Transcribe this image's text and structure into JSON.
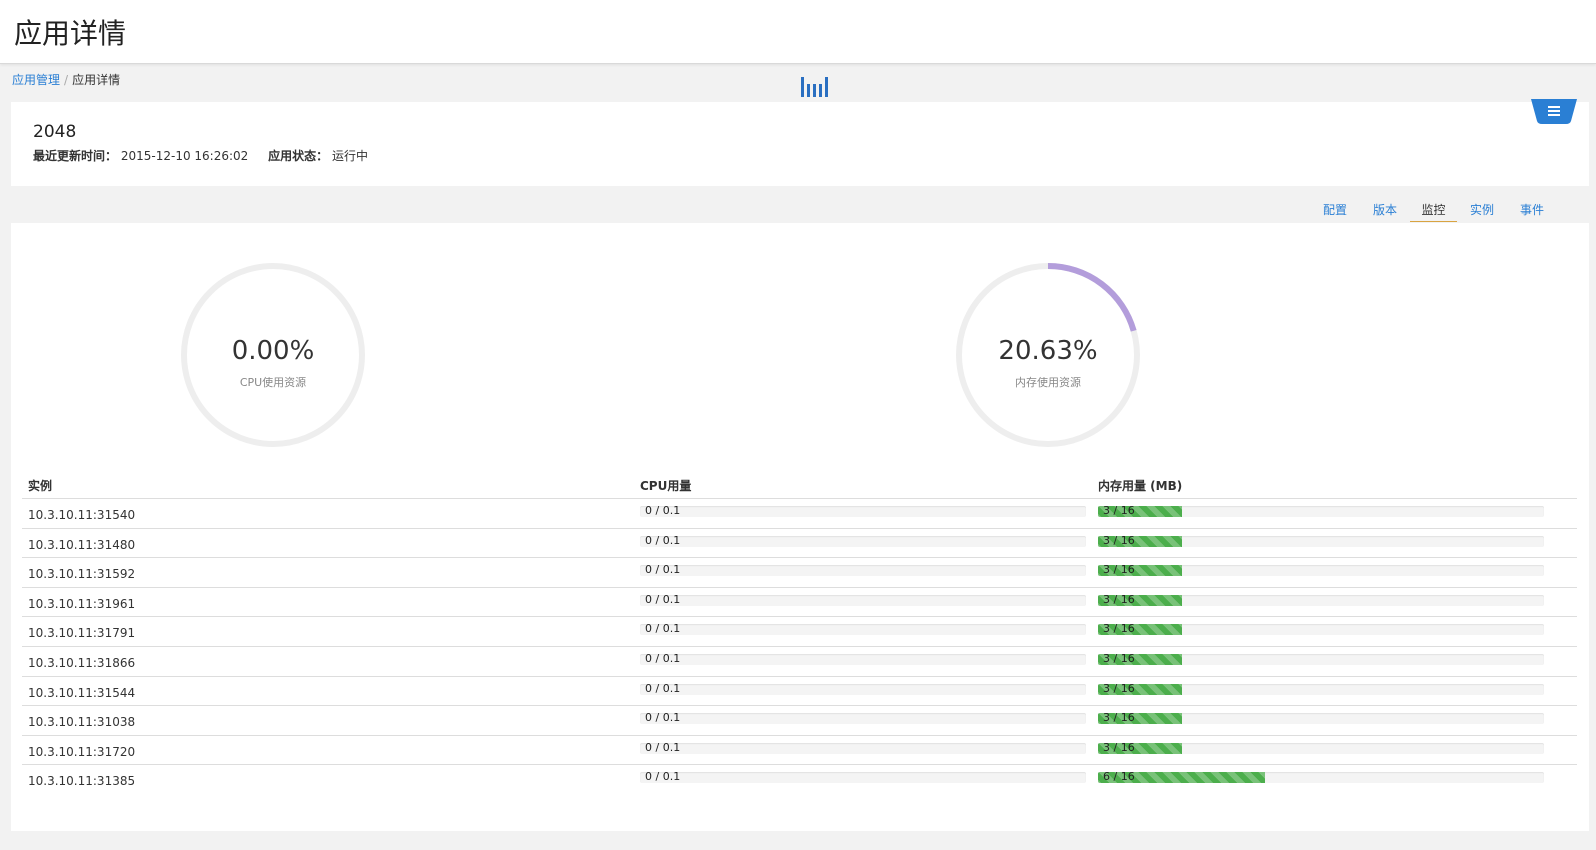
{
  "page": {
    "title": "应用详情"
  },
  "breadcrumb": {
    "parent": "应用管理",
    "separator": "/",
    "current": "应用详情"
  },
  "app": {
    "name": "2048",
    "updated_label": "最近更新时间：",
    "updated_value": "2015-12-10 16:26:02",
    "status_label": "应用状态：",
    "status_value": "运行中"
  },
  "tabs": [
    {
      "label": "配置",
      "active": false
    },
    {
      "label": "版本",
      "active": false
    },
    {
      "label": "监控",
      "active": true
    },
    {
      "label": "实例",
      "active": false
    },
    {
      "label": "事件",
      "active": false
    }
  ],
  "gauges": [
    {
      "value": "0.00%",
      "label": "CPU使用资源",
      "fraction": 0.0,
      "color": "#b39ddb"
    },
    {
      "value": "20.63%",
      "label": "内存使用资源",
      "fraction": 0.2063,
      "color": "#b39ddb"
    }
  ],
  "table": {
    "headers": {
      "instance": "实例",
      "cpu": "CPU用量",
      "mem": "内存用量 (MB)"
    },
    "rows": [
      {
        "instance": "10.3.10.11:31540",
        "cpu": "0 / 0.1",
        "cpu_fraction": 0,
        "mem": "3 / 16",
        "mem_fraction": 0.1875
      },
      {
        "instance": "10.3.10.11:31480",
        "cpu": "0 / 0.1",
        "cpu_fraction": 0,
        "mem": "3 / 16",
        "mem_fraction": 0.1875
      },
      {
        "instance": "10.3.10.11:31592",
        "cpu": "0 / 0.1",
        "cpu_fraction": 0,
        "mem": "3 / 16",
        "mem_fraction": 0.1875
      },
      {
        "instance": "10.3.10.11:31961",
        "cpu": "0 / 0.1",
        "cpu_fraction": 0,
        "mem": "3 / 16",
        "mem_fraction": 0.1875
      },
      {
        "instance": "10.3.10.11:31791",
        "cpu": "0 / 0.1",
        "cpu_fraction": 0,
        "mem": "3 / 16",
        "mem_fraction": 0.1875
      },
      {
        "instance": "10.3.10.11:31866",
        "cpu": "0 / 0.1",
        "cpu_fraction": 0,
        "mem": "3 / 16",
        "mem_fraction": 0.1875
      },
      {
        "instance": "10.3.10.11:31544",
        "cpu": "0 / 0.1",
        "cpu_fraction": 0,
        "mem": "3 / 16",
        "mem_fraction": 0.1875
      },
      {
        "instance": "10.3.10.11:31038",
        "cpu": "0 / 0.1",
        "cpu_fraction": 0,
        "mem": "3 / 16",
        "mem_fraction": 0.1875
      },
      {
        "instance": "10.3.10.11:31720",
        "cpu": "0 / 0.1",
        "cpu_fraction": 0,
        "mem": "3 / 16",
        "mem_fraction": 0.1875
      },
      {
        "instance": "10.3.10.11:31385",
        "cpu": "0 / 0.1",
        "cpu_fraction": 0,
        "mem": "6 / 16",
        "mem_fraction": 0.375
      }
    ]
  },
  "icons": {
    "monitor": "bar-chart-icon",
    "corner": "list-icon"
  },
  "colors": {
    "accent": "#2a7fd4",
    "progress": "#4cae4c",
    "gauge_track": "#eeeeee",
    "tab_underline": "#d9a441"
  }
}
